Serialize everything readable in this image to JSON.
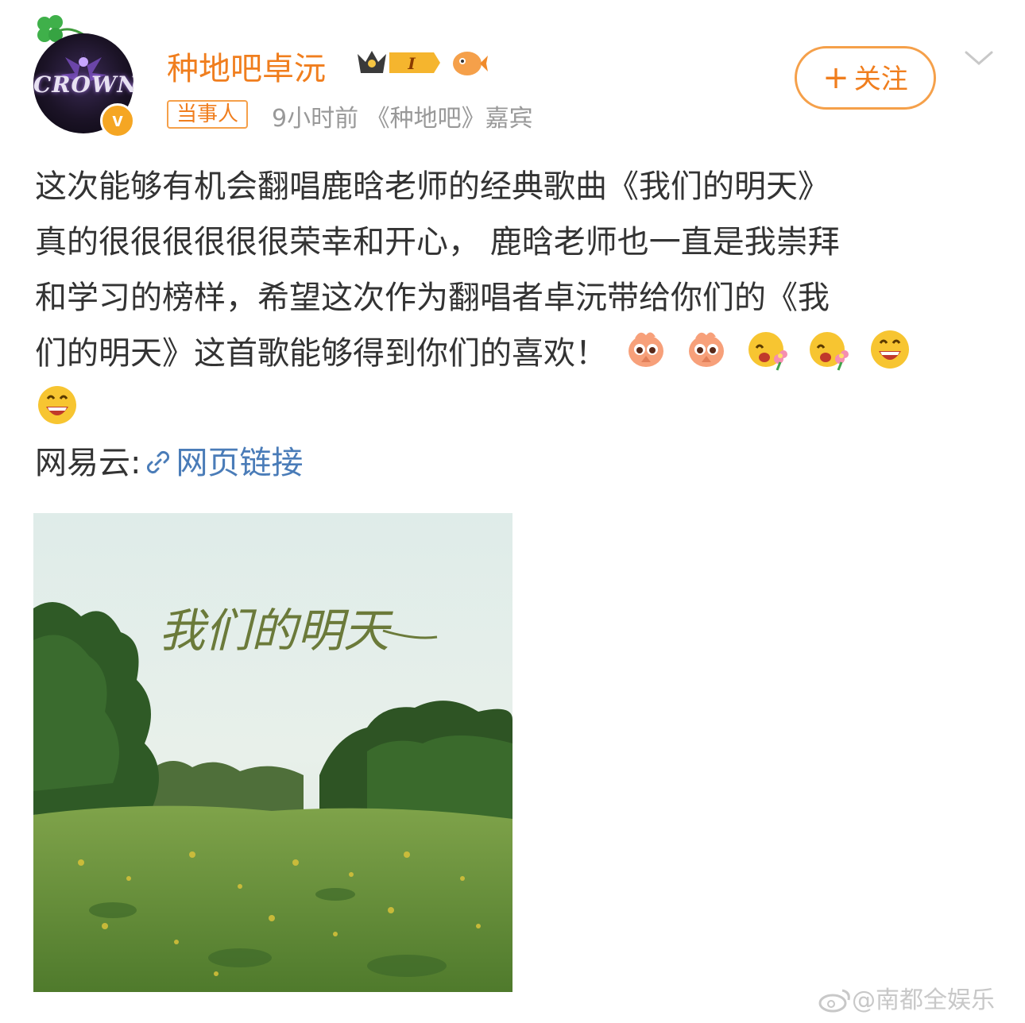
{
  "post": {
    "author": {
      "name": "种地吧卓沅",
      "level_badge": "I",
      "tag": "当事人",
      "verified_mark": "v"
    },
    "meta": "9小时前 《种地吧》嘉宾",
    "follow_button": {
      "plus": "+",
      "label": "关注"
    },
    "text_lines": [
      "这次能够有机会翻唱鹿晗老师的经典歌曲《我们的明天》",
      "真的很很很很很很荣幸和开心， 鹿晗老师也一直是我崇拜",
      "和学习的榜样，希望这次作为翻唱者卓沅带给你们的《我",
      "们的明天》这首歌能够得到你们的喜欢！"
    ],
    "emojis": [
      "pray-emoji",
      "pray-emoji",
      "flower-emoji",
      "flower-emoji",
      "laugh-emoji",
      "laugh-emoji"
    ],
    "link": {
      "prefix": "网易云:",
      "text": "网页链接",
      "color": "#4a7cb8"
    },
    "image": {
      "calligraphy_text": "我们的明天"
    }
  },
  "watermark": "@南都全娱乐",
  "colors": {
    "accent": "#f07e1e",
    "meta": "#999999",
    "text": "#333333"
  }
}
